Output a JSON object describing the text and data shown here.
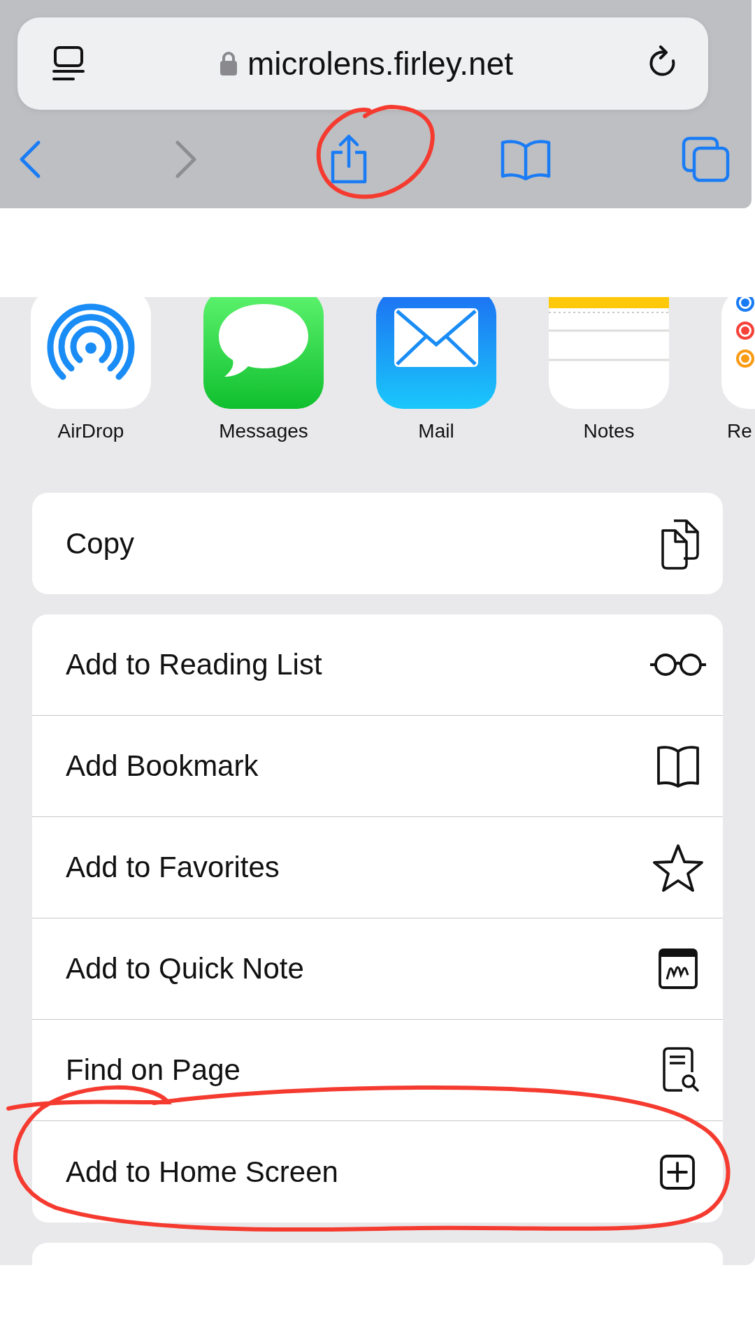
{
  "address_bar": {
    "url": "microlens.firley.net"
  },
  "nav_buttons": [
    {
      "kind": "back",
      "disabled": false
    },
    {
      "kind": "forward",
      "disabled": true
    },
    {
      "kind": "share",
      "disabled": false
    },
    {
      "kind": "bookmarks",
      "disabled": false
    },
    {
      "kind": "tabs",
      "disabled": false
    }
  ],
  "apps": [
    {
      "name": "AirDrop",
      "kind": "airdrop"
    },
    {
      "name": "Messages",
      "kind": "messages"
    },
    {
      "name": "Mail",
      "kind": "mail"
    },
    {
      "name": "Notes",
      "kind": "notes"
    },
    {
      "name": "Re",
      "kind": "reminders"
    }
  ],
  "action_groups": [
    [
      {
        "label": "Copy",
        "kind": "copy"
      }
    ],
    [
      {
        "label": "Add to Reading List",
        "kind": "glasses"
      },
      {
        "label": "Add Bookmark",
        "kind": "book"
      },
      {
        "label": "Add to Favorites",
        "kind": "star"
      },
      {
        "label": "Add to Quick Note",
        "kind": "quicknote"
      },
      {
        "label": "Find on Page",
        "kind": "find"
      },
      {
        "label": "Add to Home Screen",
        "kind": "add"
      }
    ]
  ]
}
